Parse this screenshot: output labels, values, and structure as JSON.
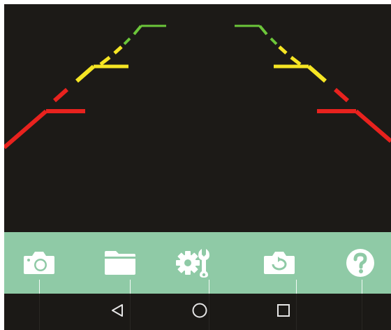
{
  "colors": {
    "camera_background": "#1c1a17",
    "toolbar_background": "#8fcaa6",
    "nav_background": "#1b1916",
    "guide_red": "#e8221e",
    "guide_yellow": "#f5e524",
    "guide_green": "#6cc63a",
    "icon": "#ffffff",
    "nav_icon": "#e6e6e6"
  },
  "toolbar": {
    "items": [
      {
        "icon": "camera-icon",
        "action": "take-photo"
      },
      {
        "icon": "folder-icon",
        "action": "open-gallery"
      },
      {
        "icon": "settings-tools-icon",
        "action": "open-settings"
      },
      {
        "icon": "switch-camera-icon",
        "action": "rotate-camera"
      },
      {
        "icon": "help-icon",
        "action": "open-help"
      }
    ]
  },
  "navbar": {
    "items": [
      {
        "icon": "back-triangle-icon"
      },
      {
        "icon": "home-circle-icon"
      },
      {
        "icon": "recents-square-icon"
      }
    ]
  }
}
